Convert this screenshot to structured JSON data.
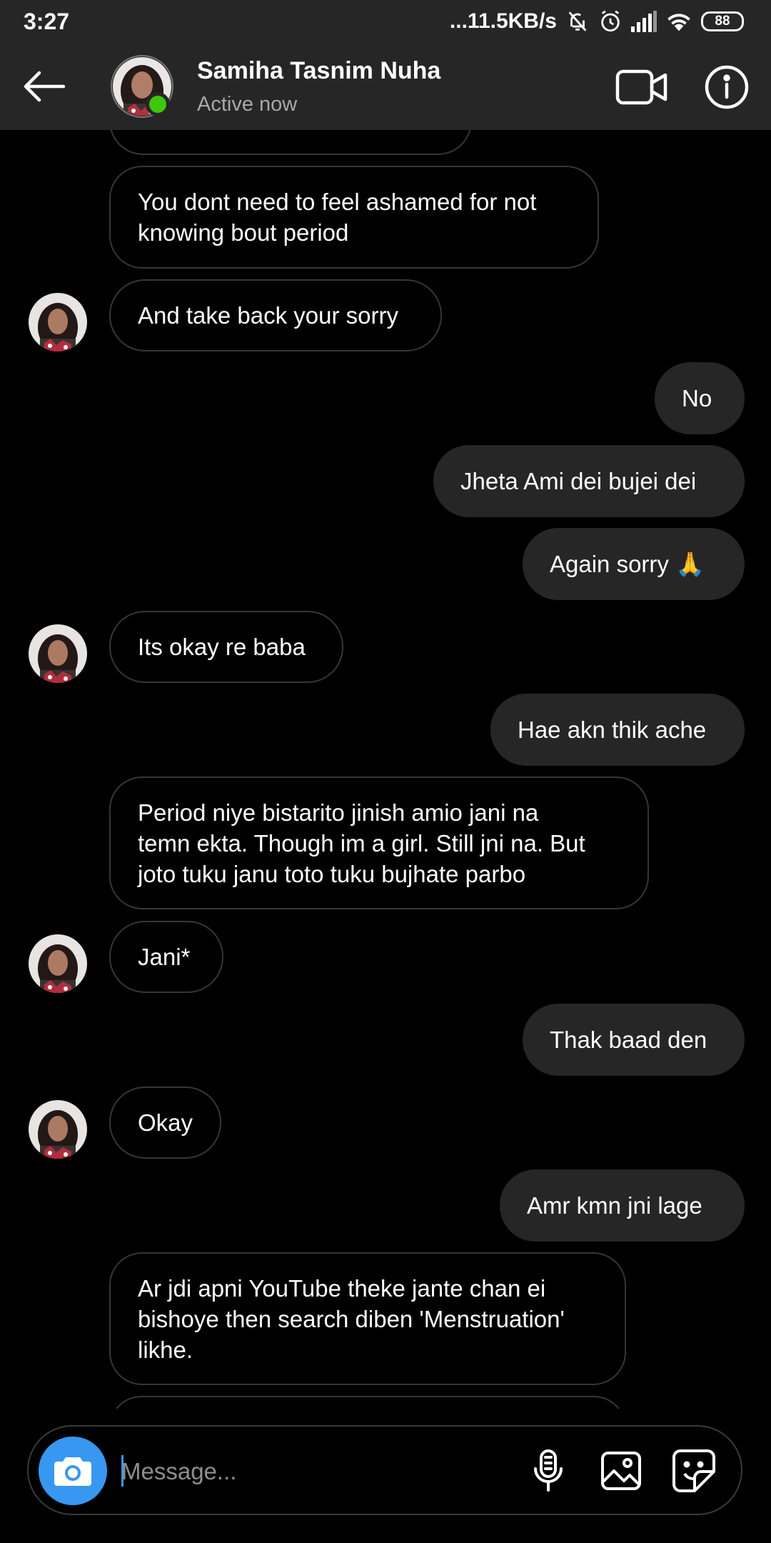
{
  "status_bar": {
    "time": "3:27",
    "net_speed": "...11.5KB/s",
    "battery": "88"
  },
  "header": {
    "name": "Samiha Tasnim Nuha",
    "status": "Active now"
  },
  "messages": [
    {
      "side": "recv",
      "text": "You dont need to feel ashamed for not\nknowing bout period",
      "avatar": false
    },
    {
      "side": "recv",
      "text": "And take back your sorry",
      "avatar": true
    },
    {
      "side": "sent",
      "text": "No"
    },
    {
      "side": "sent",
      "text": "Jheta Ami dei bujei dei"
    },
    {
      "side": "sent",
      "text": "Again sorry 🙏"
    },
    {
      "side": "recv",
      "text": "Its okay re baba",
      "avatar": true
    },
    {
      "side": "sent",
      "text": "Hae akn thik ache"
    },
    {
      "side": "recv",
      "text": "Period niye bistarito jinish amio jani na\ntemn ekta. Though im a girl. Still jni na. But\njoto tuku janu toto tuku bujhate parbo",
      "avatar": false
    },
    {
      "side": "recv",
      "text": "Jani*",
      "avatar": true
    },
    {
      "side": "sent",
      "text": "Thak baad den"
    },
    {
      "side": "recv",
      "text": "Okay",
      "avatar": true
    },
    {
      "side": "sent",
      "text": "Amr kmn jni lage"
    },
    {
      "side": "recv",
      "text": "Ar jdi apni YouTube theke jante chan ei\nbishoye then search diben 'Menstruation'\nlikhe.",
      "avatar": false
    }
  ],
  "composer": {
    "placeholder": "Message..."
  },
  "colors": {
    "header_bg": "#262626",
    "sent_bubble": "#262626",
    "accent_blue": "#3897f0",
    "online_green": "#3ec70b"
  },
  "icons": [
    "back-arrow-icon",
    "video-camera-icon",
    "info-icon",
    "camera-icon",
    "microphone-icon",
    "gallery-icon",
    "sticker-icon"
  ]
}
